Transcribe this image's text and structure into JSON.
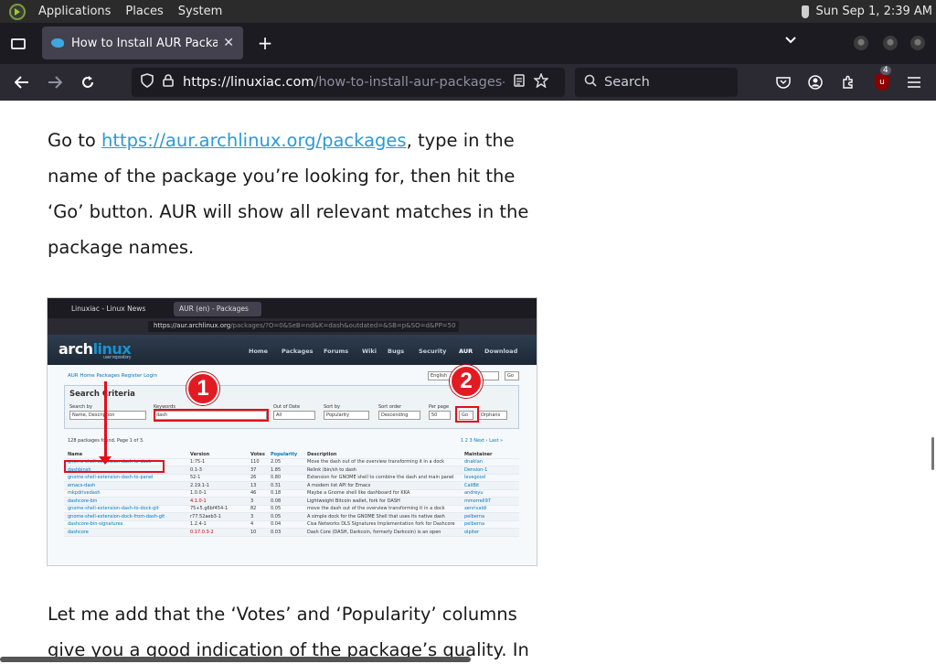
{
  "panel": {
    "applications": "Applications",
    "places": "Places",
    "system": "System",
    "clock": "Sun Sep  1,  2:39 AM"
  },
  "browser": {
    "tab_title": "How to Install AUR Packages",
    "close_glyph": "✕",
    "new_tab_glyph": "+",
    "url_host": "https://linuxiac.com",
    "url_path": "/how-to-install-aur-packages-in-arch-linux/",
    "search_placeholder": "Search",
    "extension_badge": "4"
  },
  "article": {
    "p1_prefix": "Go to ",
    "p1_link": "https://aur.archlinux.org/packages",
    "p1_suffix": ", type in the name of the package you’re looking for, then hit the ‘Go’ button. AUR will show all relevant matches in the package names.",
    "p2": "Let me add that the ‘Votes’ and ‘Popularity’ columns give you a good indication of the package’s quality. In"
  },
  "screenshot": {
    "tab1": "Linuxiac - Linux News",
    "tab2": "AUR (en) - Packages",
    "url_host": "https://aur.archlinux.org",
    "url_path": "/packages/?O=0&SeB=nd&K=dash&outdated=&SB=p&SO=d&PP=50",
    "logo_arch": "arch",
    "logo_linux": "linux",
    "logo_sub": "user repository",
    "menu": [
      "Home",
      "Packages",
      "Forums",
      "Wiki",
      "Bugs",
      "Security",
      "AUR",
      "Download"
    ],
    "sub_links": "AUR Home   Packages   Register   Login",
    "lang": "English",
    "lang_go": "Go",
    "search_title": "Search Criteria",
    "fields": [
      {
        "label": "Search by",
        "value": "Name, Description"
      },
      {
        "label": "Keywords",
        "value": "dash"
      },
      {
        "label": "Out of Date",
        "value": "All"
      },
      {
        "label": "Sort by",
        "value": "Popularity"
      },
      {
        "label": "Sort order",
        "value": "Descending"
      },
      {
        "label": "Per page",
        "value": "50"
      }
    ],
    "go_button": "Go",
    "orphans_button": "Orphans",
    "results_count": "128 packages found. Page 1 of 3.",
    "pager": "1  2  3   Next ›   Last »",
    "columns": [
      "Name",
      "Version",
      "Votes",
      "Popularity",
      "Description",
      "Maintainer"
    ],
    "rows": [
      [
        "gnome-shell-extension-dash-to-dock",
        "1:75-1",
        "110",
        "2.05",
        "Move the dash out of the overview transforming it in a dock",
        "dnaklan",
        false
      ],
      [
        "dashbinsh",
        "0.1-3",
        "37",
        "1.85",
        "Relink /bin/sh to dash",
        "Dension-1",
        false
      ],
      [
        "gnome-shell-extension-dash-to-panel",
        "52-1",
        "26",
        "0.80",
        "Extension for GNOME shell to combine the dash and main panel",
        "levegood",
        false
      ],
      [
        "emacs-dash",
        "2.19.1-1",
        "13",
        "0.31",
        "A modern list API for Emacs",
        "CaliBit",
        false
      ],
      [
        "mkpdrivedash",
        "1.0.0-1",
        "46",
        "0.18",
        "Maybe a Gnome shell like dashboard for KKA",
        "andreyu",
        false
      ],
      [
        "dashcore-bin",
        "4.1.0-1",
        "3",
        "0.08",
        "Lightweight Bitcoin wallet, fork for DASH",
        "mmorrell97",
        true
      ],
      [
        "gnome-shell-extension-dash-to-dock-git",
        "75+5.g6bf454-1",
        "82",
        "0.05",
        "move the dash out of the overview transforming it in a dock",
        "xenrivaldi",
        false
      ],
      [
        "gnome-shell-extension-dock-from-dash-git",
        "r77.52aeb3-1",
        "3",
        "0.05",
        "A simple dock for the GNOME Shell that uses its native dash",
        "pelberna",
        false
      ],
      [
        "dashcore-bin-signatures",
        "1.2.4-1",
        "4",
        "0.04",
        "Cisa Networks DLS Signatures Implementation fork for Dashcore",
        "pelberna",
        false
      ],
      [
        "dashcore",
        "0.17.0.3-2",
        "10",
        "0.03",
        "Dash Core (DASH, Darkcoin, formerly Darkcoin) is an open",
        "olpiter",
        true
      ]
    ],
    "callout1": "1",
    "callout2": "2"
  }
}
